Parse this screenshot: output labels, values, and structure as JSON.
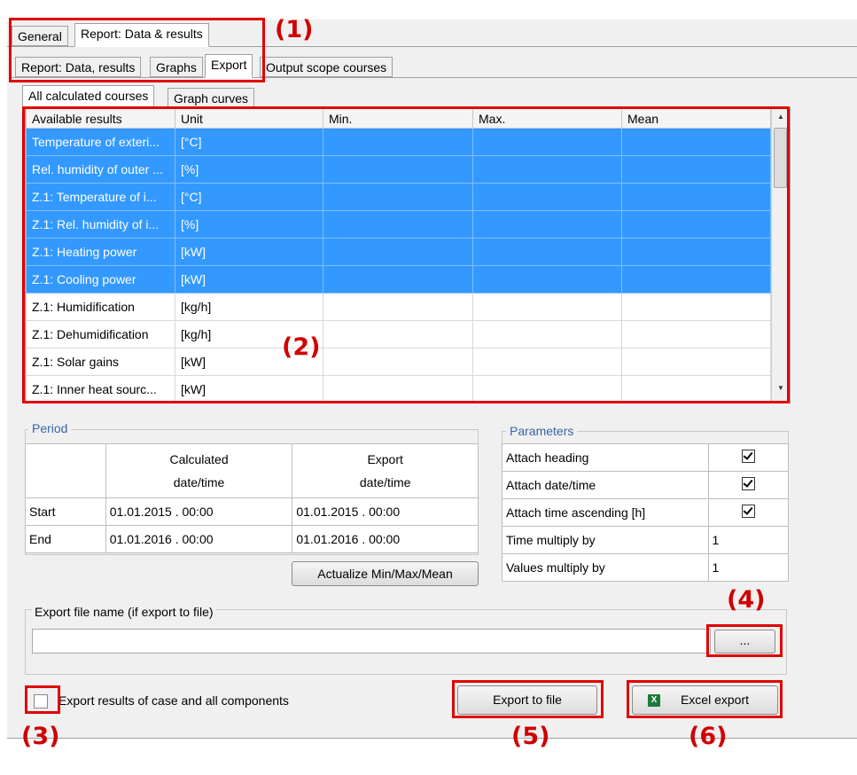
{
  "top_tabs": [
    "General",
    "Report: Data & results"
  ],
  "sub_tabs": [
    "Report: Data, results",
    "Graphs",
    "Export",
    "Output scope courses"
  ],
  "inner_tabs": [
    "All calculated courses",
    "Graph curves"
  ],
  "results_table": {
    "columns": [
      "Available results",
      "Unit",
      "Min.",
      "Max.",
      "Mean"
    ],
    "rows": [
      {
        "name": "Temperature of exteri...",
        "unit": "[°C]",
        "selected": true
      },
      {
        "name": "Rel. humidity of outer ...",
        "unit": "[%]",
        "selected": true
      },
      {
        "name": "Z.1: Temperature of i...",
        "unit": "[°C]",
        "selected": true
      },
      {
        "name": "Z.1: Rel. humidity of i...",
        "unit": "[%]",
        "selected": true
      },
      {
        "name": "Z.1: Heating power",
        "unit": "[kW]",
        "selected": true
      },
      {
        "name": "Z.1: Cooling power",
        "unit": "[kW]",
        "selected": true
      },
      {
        "name": "Z.1: Humidification",
        "unit": "[kg/h]",
        "selected": false
      },
      {
        "name": "Z.1: Dehumidification",
        "unit": "[kg/h]",
        "selected": false
      },
      {
        "name": "Z.1: Solar gains",
        "unit": "[kW]",
        "selected": false
      },
      {
        "name": "Z.1: Inner heat sourc...",
        "unit": "[kW]",
        "selected": false
      }
    ]
  },
  "period": {
    "legend": "Period",
    "col_calculated_1": "Calculated",
    "col_calculated_2": "date/time",
    "col_export_1": "Export",
    "col_export_2": "date/time",
    "start_label": "Start",
    "start_calculated": "01.01.2015 . 00:00",
    "start_export": "01.01.2015 . 00:00",
    "end_label": "End",
    "end_calculated": "01.01.2016 . 00:00",
    "end_export": "01.01.2016 . 00:00",
    "actualize_button": "Actualize Min/Max/Mean"
  },
  "parameters": {
    "legend": "Parameters",
    "attach_heading": "Attach heading",
    "attach_heading_checked": true,
    "attach_datetime": "Attach date/time",
    "attach_datetime_checked": true,
    "attach_time_ascending": "Attach time ascending [h]",
    "attach_time_ascending_checked": true,
    "time_multiply": "Time multiply by",
    "time_multiply_value": "1",
    "values_multiply": "Values multiply by",
    "values_multiply_value": "1"
  },
  "export_file": {
    "label": "Export file name (if export to file)",
    "value": "",
    "browse_button": "..."
  },
  "export_all_checkbox": {
    "label": "Export results of case and all components",
    "checked": false
  },
  "buttons": {
    "export_to_file": "Export to file",
    "excel_export": "Excel export"
  },
  "callouts": [
    "(1)",
    "(2)",
    "(3)",
    "(4)",
    "(5)",
    "(6)"
  ]
}
